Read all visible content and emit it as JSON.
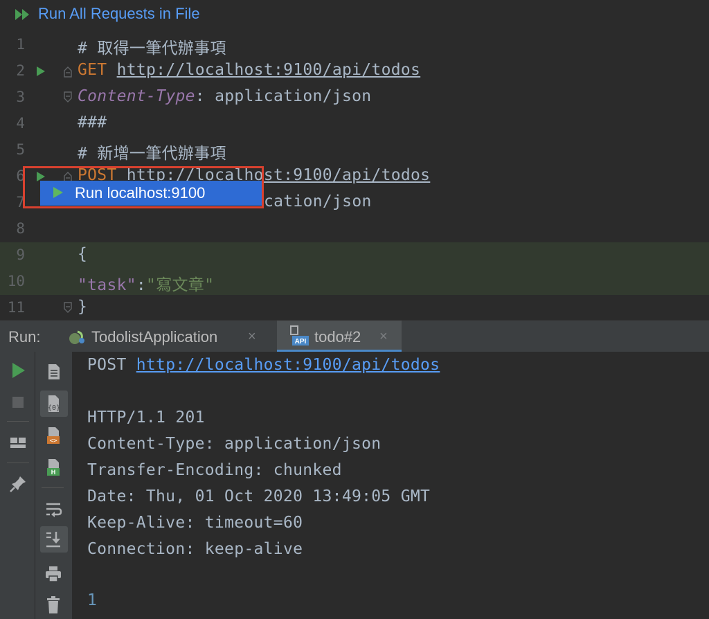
{
  "toolbar": {
    "run_all_label": "Run All Requests in File"
  },
  "editor": {
    "line_numbers": [
      "1",
      "2",
      "3",
      "4",
      "5",
      "6",
      "7",
      "8",
      "9",
      "10",
      "11"
    ],
    "line1": "# 取得一筆代辦事項",
    "line2_method": "GET",
    "line2_url": "http://localhost:9100/api/todos",
    "line3_header": "Content-Type",
    "line3_value": ": application/json",
    "line4": "###",
    "line5": "# 新增一筆代辦事項",
    "line6_method": "POST",
    "line6_url": "http://localhost:9100/api/todos",
    "line7_tail": "cation/json",
    "line9": "{",
    "line10_key": "\"task\"",
    "line10_colon": ":",
    "line10_value": "\"寫文章\"",
    "line11": "}"
  },
  "popup": {
    "label": "Run localhost:9100"
  },
  "run_panel": {
    "label": "Run:",
    "tabs": [
      {
        "label": "TodolistApplication",
        "close": "×"
      },
      {
        "label": "todo#2",
        "close": "×"
      }
    ]
  },
  "console": {
    "request_method": "POST ",
    "request_url": "http://localhost:9100/api/todos",
    "lines": [
      "HTTP/1.1 201",
      "Content-Type: application/json",
      "Transfer-Encoding: chunked",
      "Date: Thu, 01 Oct 2020 13:49:05 GMT",
      "Keep-Alive: timeout=60",
      "Connection: keep-alive"
    ],
    "body": "1"
  },
  "colors": {
    "accent_blue": "#589df6",
    "run_green": "#499c54",
    "popup_bg": "#2e6bd4",
    "highlight_border": "#d9412f"
  }
}
